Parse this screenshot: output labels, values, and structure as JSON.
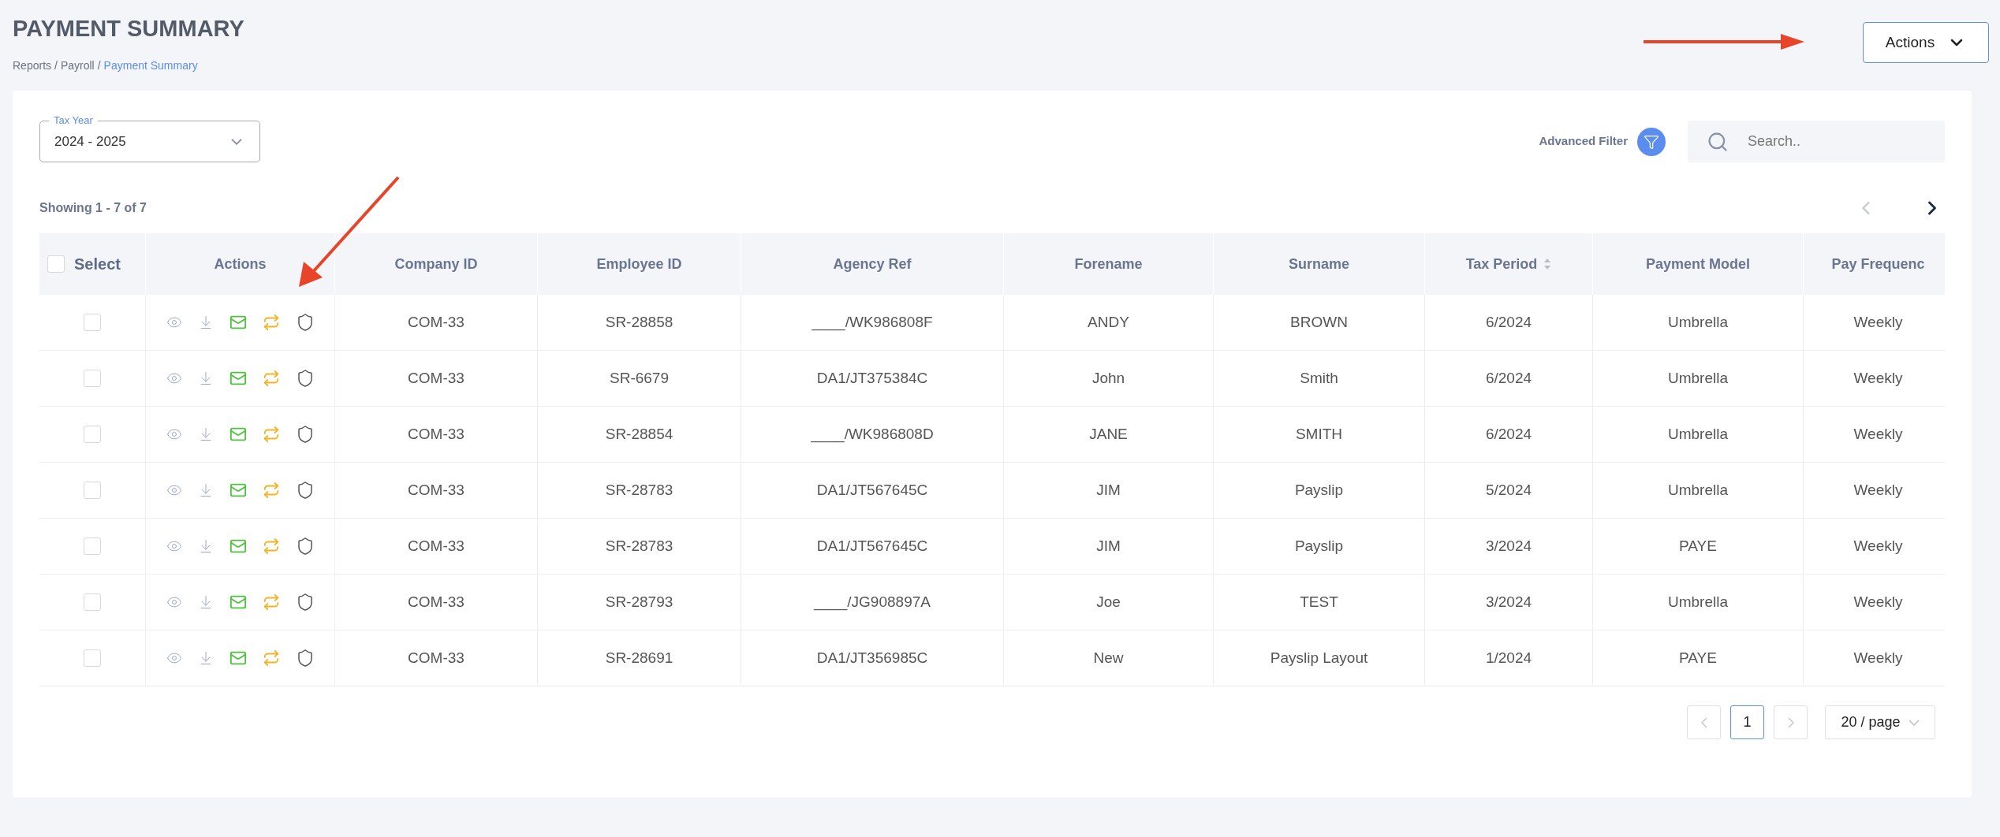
{
  "page": {
    "title": "PAYMENT SUMMARY",
    "breadcrumb": [
      {
        "label": "Reports",
        "current": false
      },
      {
        "label": "Payroll",
        "current": false
      },
      {
        "label": "Payment Summary",
        "current": true
      }
    ],
    "separator": "/",
    "actions_button": {
      "label": "Actions"
    }
  },
  "filters": {
    "tax_year": {
      "label": "Tax Year",
      "value": "2024 - 2025"
    },
    "advanced_filter": {
      "label": "Advanced Filter"
    },
    "search": {
      "placeholder": "Search.."
    }
  },
  "showing": "Showing 1 - 7 of 7",
  "top_nav": {
    "prev_disabled": true,
    "next_disabled": false
  },
  "table": {
    "select_all": {
      "label": "Select",
      "checked": false
    },
    "columns": [
      {
        "label": "Actions",
        "sortable": false
      },
      {
        "label": "Company ID",
        "sortable": false
      },
      {
        "label": "Employee ID",
        "sortable": false
      },
      {
        "label": "Agency Ref",
        "sortable": false
      },
      {
        "label": "Forename",
        "sortable": false
      },
      {
        "label": "Surname",
        "sortable": false
      },
      {
        "label": "Tax Period",
        "sortable": true
      },
      {
        "label": "Payment Model",
        "sortable": false
      },
      {
        "label": "Pay Frequenc",
        "sortable": false
      }
    ],
    "rows": [
      {
        "checked": false,
        "cells": [
          "",
          "COM-33",
          "SR-28858",
          "____/WK986808F",
          "ANDY",
          "BROWN",
          "6/2024",
          "Umbrella",
          "Weekly"
        ]
      },
      {
        "checked": false,
        "cells": [
          "",
          "COM-33",
          "SR-6679",
          "DA1/JT375384C",
          "John",
          "Smith",
          "6/2024",
          "Umbrella",
          "Weekly"
        ]
      },
      {
        "checked": false,
        "cells": [
          "",
          "COM-33",
          "SR-28854",
          "____/WK986808D",
          "JANE",
          "SMITH",
          "6/2024",
          "Umbrella",
          "Weekly"
        ]
      },
      {
        "checked": false,
        "cells": [
          "",
          "COM-33",
          "SR-28783",
          "DA1/JT567645C",
          "JIM",
          "Payslip",
          "5/2024",
          "Umbrella",
          "Weekly"
        ]
      },
      {
        "checked": false,
        "cells": [
          "",
          "COM-33",
          "SR-28783",
          "DA1/JT567645C",
          "JIM",
          "Payslip",
          "3/2024",
          "PAYE",
          "Weekly"
        ]
      },
      {
        "checked": false,
        "cells": [
          "",
          "COM-33",
          "SR-28793",
          "____/JG908897A",
          "Joe",
          "TEST",
          "3/2024",
          "Umbrella",
          "Weekly"
        ]
      },
      {
        "checked": false,
        "cells": [
          "",
          "COM-33",
          "SR-28691",
          "DA1/JT356985C",
          "New",
          "Payslip Layout",
          "1/2024",
          "PAYE",
          "Weekly"
        ]
      }
    ]
  },
  "pagination": {
    "prev_disabled": true,
    "next_disabled": true,
    "pages": [
      {
        "label": "1",
        "selected": true
      }
    ],
    "page_size": "20 / page"
  }
}
